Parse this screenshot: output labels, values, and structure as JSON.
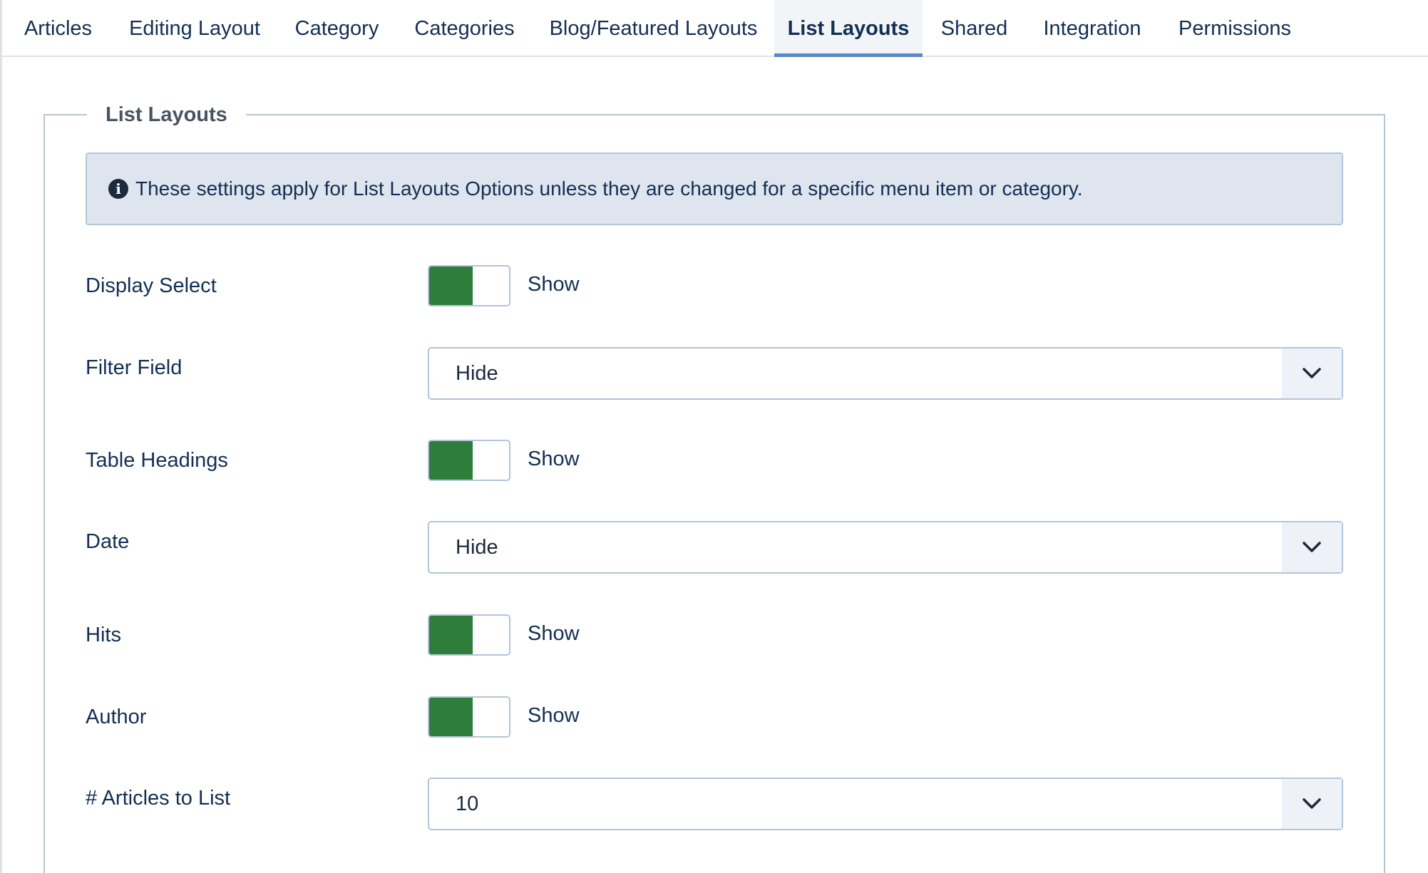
{
  "tabs": [
    {
      "label": "Articles"
    },
    {
      "label": "Editing Layout"
    },
    {
      "label": "Category"
    },
    {
      "label": "Categories"
    },
    {
      "label": "Blog/Featured Layouts"
    },
    {
      "label": "List Layouts",
      "active": true
    },
    {
      "label": "Shared"
    },
    {
      "label": "Integration"
    },
    {
      "label": "Permissions"
    }
  ],
  "fieldset": {
    "legend": "List Layouts",
    "info": "These settings apply for List Layouts Options unless they are changed for a specific menu item or category."
  },
  "fields": {
    "display_select": {
      "label": "Display Select",
      "value": "Show"
    },
    "filter_field": {
      "label": "Filter Field",
      "value": "Hide"
    },
    "table_headings": {
      "label": "Table Headings",
      "value": "Show"
    },
    "date": {
      "label": "Date",
      "value": "Hide"
    },
    "hits": {
      "label": "Hits",
      "value": "Show"
    },
    "author": {
      "label": "Author",
      "value": "Show"
    },
    "articles_to_list": {
      "label": "# Articles to List",
      "value": "10"
    }
  },
  "colors": {
    "toggle_on": "#2e7d3a",
    "active_tab_underline": "#5a88c6",
    "alert_bg": "#dfe5ef",
    "text": "#132f53"
  },
  "icons": {
    "info": "info-circle-icon",
    "dropdown": "chevron-down-icon"
  }
}
